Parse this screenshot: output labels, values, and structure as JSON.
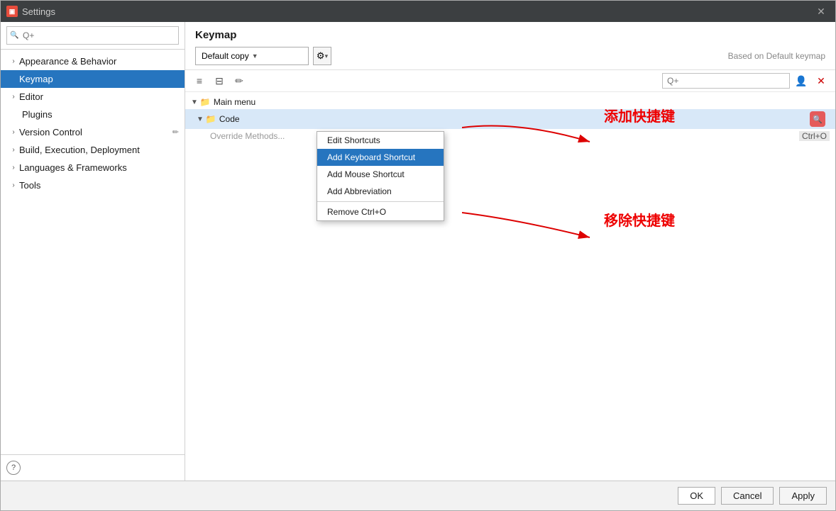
{
  "window": {
    "title": "Settings",
    "icon": "⚙",
    "close_label": "✕"
  },
  "sidebar": {
    "search_placeholder": "Q+",
    "items": [
      {
        "id": "appearance",
        "label": "Appearance & Behavior",
        "indent": 0,
        "expandable": true,
        "active": false
      },
      {
        "id": "keymap",
        "label": "Keymap",
        "indent": 0,
        "expandable": false,
        "active": true
      },
      {
        "id": "editor",
        "label": "Editor",
        "indent": 0,
        "expandable": true,
        "active": false
      },
      {
        "id": "plugins",
        "label": "Plugins",
        "indent": 1,
        "expandable": false,
        "active": false
      },
      {
        "id": "version-control",
        "label": "Version Control",
        "indent": 0,
        "expandable": true,
        "active": false
      },
      {
        "id": "build",
        "label": "Build, Execution, Deployment",
        "indent": 0,
        "expandable": true,
        "active": false
      },
      {
        "id": "languages",
        "label": "Languages & Frameworks",
        "indent": 0,
        "expandable": true,
        "active": false
      },
      {
        "id": "tools",
        "label": "Tools",
        "indent": 0,
        "expandable": true,
        "active": false
      }
    ],
    "help_label": "?"
  },
  "panel": {
    "title": "Keymap",
    "keymap_dropdown": "Default copy",
    "based_on": "Based on Default keymap",
    "gear_icon": "⚙",
    "toolbar_icons": [
      "≡",
      "≡",
      "✏"
    ]
  },
  "tree": {
    "main_menu_label": "Main menu",
    "code_label": "Code",
    "override_methods_label": "Override Methods...",
    "override_shortcut": "Ctrl+O"
  },
  "context_menu": {
    "items": [
      {
        "id": "edit-shortcuts",
        "label": "Edit Shortcuts",
        "selected": false
      },
      {
        "id": "add-keyboard-shortcut",
        "label": "Add Keyboard Shortcut",
        "selected": true
      },
      {
        "id": "add-mouse-shortcut",
        "label": "Add Mouse Shortcut",
        "selected": false
      },
      {
        "id": "add-abbreviation",
        "label": "Add Abbreviation",
        "selected": false
      },
      {
        "id": "remove-ctrl-o",
        "label": "Remove Ctrl+O",
        "selected": false
      }
    ]
  },
  "annotations": {
    "add_shortcut": "添加快捷键",
    "remove_shortcut": "移除快捷键"
  },
  "bottom_bar": {
    "ok_label": "OK",
    "cancel_label": "Cancel",
    "apply_label": "Apply"
  }
}
